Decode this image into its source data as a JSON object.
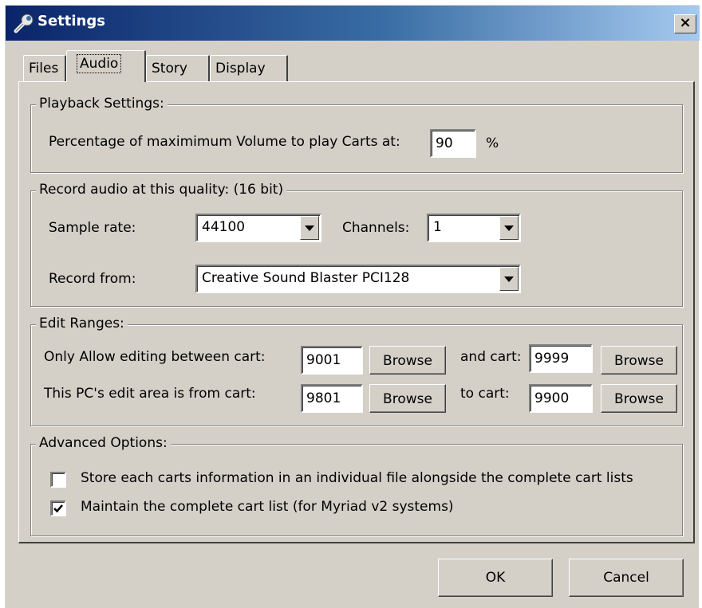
{
  "window": {
    "title": "Settings",
    "close_label": "×"
  },
  "tabs": [
    {
      "label": "Files"
    },
    {
      "label": "Audio"
    },
    {
      "label": "Story"
    },
    {
      "label": "Display"
    }
  ],
  "playback": {
    "legend": "Playback Settings:",
    "volume_label": "Percentage of maximimum Volume to play Carts at:",
    "volume_value": "90",
    "volume_unit": "%"
  },
  "record": {
    "legend": "Record audio at this quality: (16 bit)",
    "sample_rate_label": "Sample rate:",
    "sample_rate_value": "44100",
    "channels_label": "Channels:",
    "channels_value": "1",
    "record_from_label": "Record from:",
    "record_from_value": "Creative Sound Blaster PCI128"
  },
  "edit_ranges": {
    "legend": "Edit Ranges:",
    "allow_label": "Only Allow editing between cart:",
    "allow_from": "9001",
    "and_label": "and cart:",
    "allow_to": "9999",
    "pc_label": "This PC's edit area is from cart:",
    "pc_from": "9801",
    "to_label": "to cart:",
    "pc_to": "9900",
    "browse_label": "Browse"
  },
  "advanced": {
    "legend": "Advanced Options:",
    "option1_label": "Store each carts information in an individual file alongside the complete cart lists",
    "option1_checked": false,
    "option2_label": "Maintain the complete cart list (for Myriad v2 systems)",
    "option2_checked": true
  },
  "footer": {
    "ok_label": "OK",
    "cancel_label": "Cancel"
  }
}
